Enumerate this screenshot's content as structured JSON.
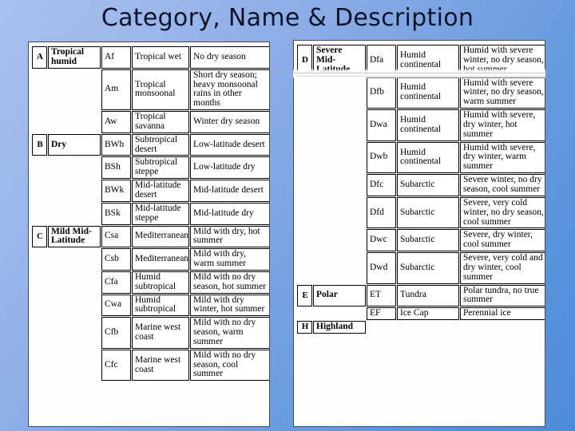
{
  "slide": {
    "title": "Category, Name & Description",
    "background_from": "#A8C0EE",
    "background_to": "#4E8BDA",
    "title_color": "#0E1426"
  },
  "left_table": {
    "groups": [
      {
        "letter": "A",
        "category": "Tropical humid",
        "rows": [
          {
            "code": "Af",
            "name": "Tropical wet",
            "description": "No dry season"
          },
          {
            "code": "Am",
            "name": "Tropical monsoonal",
            "description": "Short dry season; heavy monsoonal rains in other months"
          },
          {
            "code": "Aw",
            "name": "Tropical savanna",
            "description": "Winter dry season"
          }
        ]
      },
      {
        "letter": "B",
        "category": "Dry",
        "rows": [
          {
            "code": "BWh",
            "name": "Subtropical desert",
            "description": "Low-latitude desert"
          },
          {
            "code": "BSh",
            "name": "Subtropical steppe",
            "description": "Low-latitude dry"
          },
          {
            "code": "BWk",
            "name": "Mid-latitude desert",
            "description": "Mid-latitude desert"
          },
          {
            "code": "BSk",
            "name": "Mid-latitude steppe",
            "description": "Mid-latitude dry"
          }
        ]
      },
      {
        "letter": "C",
        "category": "Mild Mid-Latitude",
        "rows": [
          {
            "code": "Csa",
            "name": "Mediterranean",
            "description": "Mild with dry, hot summer"
          },
          {
            "code": "Csb",
            "name": "Mediterranean",
            "description": "Mild with dry, warm summer"
          },
          {
            "code": "Cfa",
            "name": "Humid subtropical",
            "description": "Mild with no dry season, hot summer"
          },
          {
            "code": "Cwa",
            "name": "Humid subtropical",
            "description": "Mild with dry winter, hot summer"
          },
          {
            "code": "Cfb",
            "name": "Marine west coast",
            "description": "Mild with no dry season, warm summer"
          },
          {
            "code": "Cfc",
            "name": "Marine west coast",
            "description": "Mild with no dry season, cool summer"
          }
        ]
      }
    ]
  },
  "right_table": {
    "groups": [
      {
        "letter": "D",
        "category": "Severe Mid-Latitude",
        "rows": [
          {
            "code": "Dfa",
            "name": "Humid continental",
            "description": "Humid with severe winter, no dry season, hot summer"
          },
          {
            "code": "Dfb",
            "name": "Humid continental",
            "description": "Humid with severe winter, no dry season, warm summer"
          },
          {
            "code": "Dwa",
            "name": "Humid continental",
            "description": "Humid with severe, dry winter, hot summer"
          },
          {
            "code": "Dwb",
            "name": "Humid continental",
            "description": "Humid with severe, dry winter, warm summer"
          },
          {
            "code": "Dfc",
            "name": "Subarctic",
            "description": "Severe winter, no dry season, cool summer"
          },
          {
            "code": "Dfd",
            "name": "Subarctic",
            "description": "Severe, very cold winter, no dry season, cool summer"
          },
          {
            "code": "Dwc",
            "name": "Subarctic",
            "description": "Severe, dry winter, cool summer"
          },
          {
            "code": "Dwd",
            "name": "Subarctic",
            "description": "Severe, very cold and dry winter, cool summer"
          }
        ]
      },
      {
        "letter": "E",
        "category": "Polar",
        "rows": [
          {
            "code": "ET",
            "name": "Tundra",
            "description": "Polar tundra, no true summer"
          },
          {
            "code": "EF",
            "name": "Ice Cap",
            "description": "Perennial ice"
          }
        ]
      },
      {
        "letter": "H",
        "category": "Highland",
        "rows": []
      }
    ]
  }
}
